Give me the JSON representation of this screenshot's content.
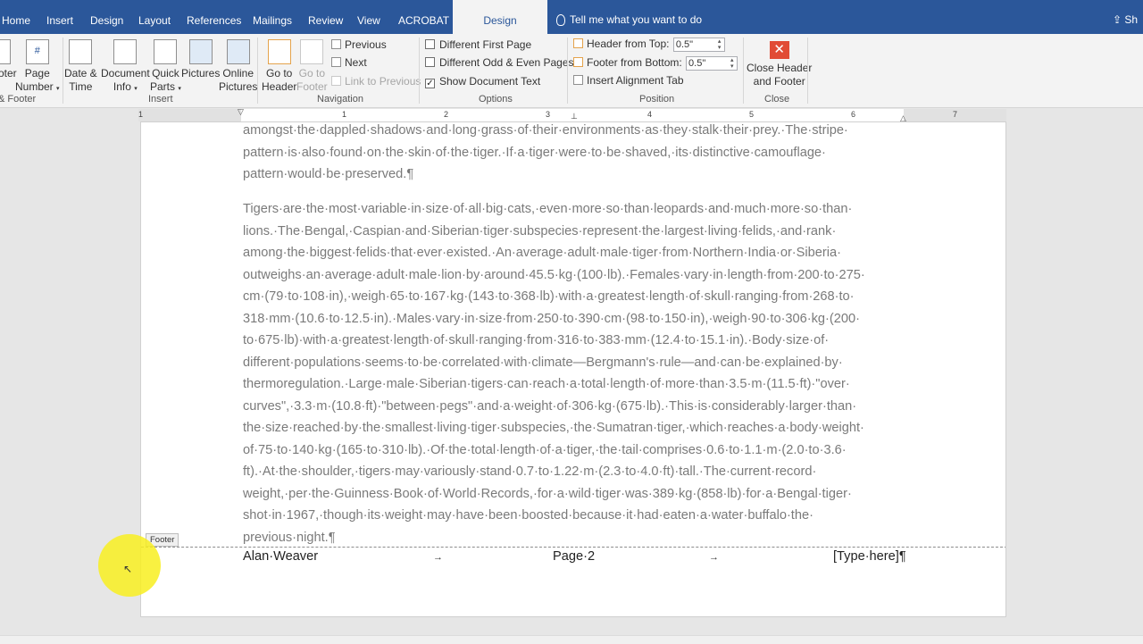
{
  "tabs": {
    "home": "Home",
    "insert": "Insert",
    "design": "Design",
    "layout": "Layout",
    "references": "References",
    "mailings": "Mailings",
    "review": "Review",
    "view": "View",
    "acrobat": "ACROBAT",
    "active_design": "Design"
  },
  "tell_me": "Tell me what you want to do",
  "share": "Sh",
  "ribbon": {
    "hf_group": {
      "partial_label_1": "oter",
      "label": "& Footer"
    },
    "insert_group": {
      "label": "Insert",
      "page_number": [
        "Page",
        "Number"
      ],
      "date_time": [
        "Date &",
        "Time"
      ],
      "document_info": [
        "Document",
        "Info"
      ],
      "quick_parts": [
        "Quick",
        "Parts"
      ],
      "pictures": [
        "Pictures",
        ""
      ],
      "online_pictures": [
        "Online",
        "Pictures"
      ]
    },
    "navigation_group": {
      "label": "Navigation",
      "go_to_header": [
        "Go to",
        "Header"
      ],
      "go_to_footer": [
        "Go to",
        "Footer"
      ],
      "previous": "Previous",
      "next": "Next",
      "link_to_previous": "Link to Previous"
    },
    "options_group": {
      "label": "Options",
      "different_first_page": "Different First Page",
      "different_odd_even": "Different Odd & Even Pages",
      "show_document_text": "Show Document Text",
      "show_document_text_checked": true
    },
    "position_group": {
      "label": "Position",
      "header_from_top_label": "Header from Top:",
      "header_from_top_value": "0.5\"",
      "footer_from_bottom_label": "Footer from Bottom:",
      "footer_from_bottom_value": "0.5\"",
      "insert_alignment_tab": "Insert Alignment Tab"
    },
    "close_group": {
      "label": "Close",
      "close_header_footer": [
        "Close Header",
        "and Footer"
      ]
    }
  },
  "ruler_numbers": [
    "1",
    "1",
    "2",
    "3",
    "4",
    "5",
    "6",
    "7"
  ],
  "body_lines": [
    "amongst·the·dappled·shadows·and·long·grass·of·their·environments·as·they·stalk·their·prey.·The·stripe·",
    "pattern·is·also·found·on·the·skin·of·the·tiger.·If·a·tiger·were·to·be·shaved,·its·distinctive·camouflage·",
    "pattern·would·be·preserved.¶",
    "Tigers·are·the·most·variable·in·size·of·all·big·cats,·even·more·so·than·leopards·and·much·more·so·than·",
    "lions.·The·Bengal,·Caspian·and·Siberian·tiger·subspecies·represent·the·largest·living·felids,·and·rank·",
    "among·the·biggest·felids·that·ever·existed.·An·average·adult·male·tiger·from·Northern·India·or·Siberia·",
    "outweighs·an·average·adult·male·lion·by·around·45.5·kg·(100·lb).·Females·vary·in·length·from·200·to·275·",
    "cm·(79·to·108·in),·weigh·65·to·167·kg·(143·to·368·lb)·with·a·greatest·length·of·skull·ranging·from·268·to·",
    "318·mm·(10.6·to·12.5·in).·Males·vary·in·size·from·250·to·390·cm·(98·to·150·in),·weigh·90·to·306·kg·(200·",
    "to·675·lb)·with·a·greatest·length·of·skull·ranging·from·316·to·383·mm·(12.4·to·15.1·in).·Body·size·of·",
    "different·populations·seems·to·be·correlated·with·climate—Bergmann's·rule—and·can·be·explained·by·",
    "thermoregulation.·Large·male·Siberian·tigers·can·reach·a·total·length·of·more·than·3.5·m·(11.5·ft)·\"over·",
    "curves\",·3.3·m·(10.8·ft)·\"between·pegs\"·and·a·weight·of·306·kg·(675·lb).·This·is·considerably·larger·than·",
    "the·size·reached·by·the·smallest·living·tiger·subspecies,·the·Sumatran·tiger,·which·reaches·a·body·weight·",
    "of·75·to·140·kg·(165·to·310·lb).·Of·the·total·length·of·a·tiger,·the·tail·comprises·0.6·to·1.1·m·(2.0·to·3.6·",
    "ft).·At·the·shoulder,·tigers·may·variously·stand·0.7·to·1.22·m·(2.3·to·4.0·ft)·tall.·The·current·record·",
    "weight,·per·the·Guinness·Book·of·World·Records,·for·a·wild·tiger·was·389·kg·(858·lb)·for·a·Bengal·tiger·",
    "shot·in·1967,·though·its·weight·may·have·been·boosted·because·it·had·eaten·a·water·buffalo·the·",
    "previous·night.¶"
  ],
  "footer": {
    "tag": "Footer",
    "left": "Alan·Weaver",
    "tab_arrow": "→",
    "center": "Page·2",
    "right": "[Type·here]¶"
  }
}
